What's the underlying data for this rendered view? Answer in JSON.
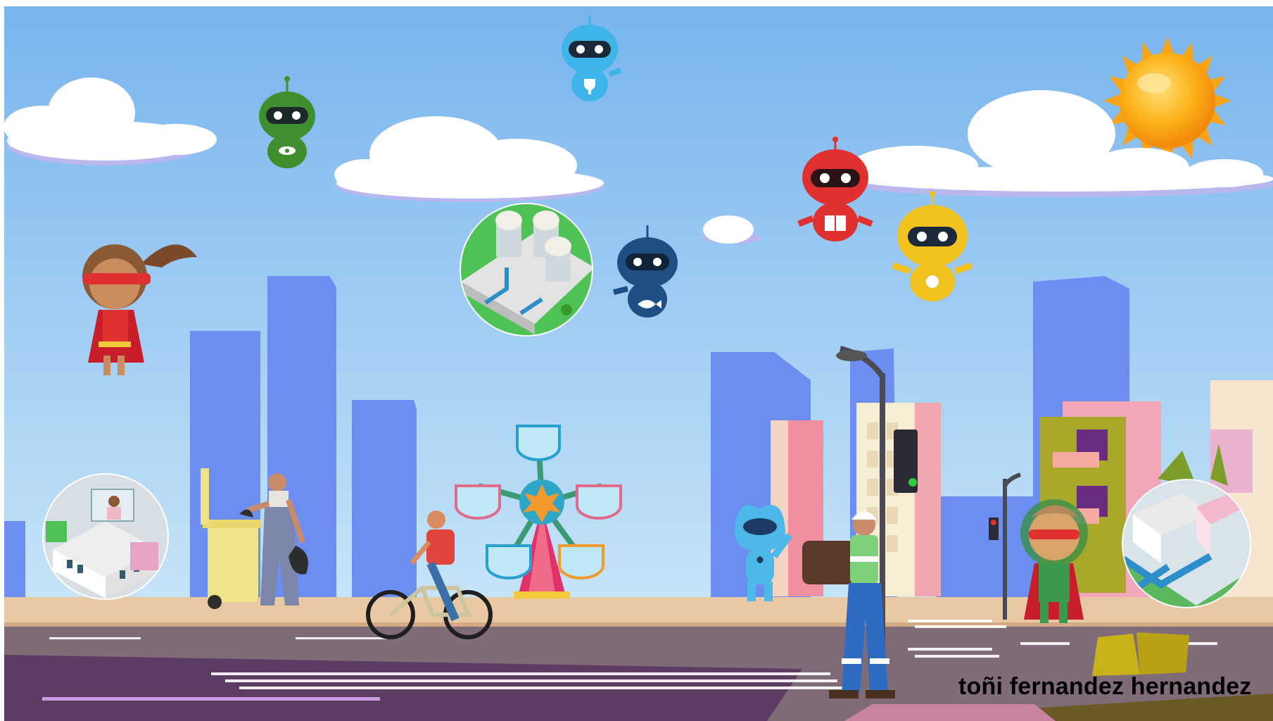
{
  "scene": {
    "credit_text": "toñi fernandez hernandez",
    "colors": {
      "sky_top": "#7ab6ef",
      "sky_bottom": "#cfe8f8",
      "buildings_far": "#6f8ff0",
      "sidewalk": "#e8c7a6",
      "road": "#7e6a78",
      "road_dark": "#5b3b62",
      "sun": "#fbb117"
    },
    "robots": [
      {
        "name": "robot-green",
        "color": "#3f8f2e",
        "badge": "eye-icon"
      },
      {
        "name": "robot-lightblue",
        "color": "#3fb4e8",
        "badge": "trophy-icon"
      },
      {
        "name": "robot-navy",
        "color": "#1f4e84",
        "badge": "fish-icon"
      },
      {
        "name": "robot-red",
        "color": "#e0302f",
        "badge": "book-icon"
      },
      {
        "name": "robot-yellow",
        "color": "#f1c21e",
        "badge": "sun-icon"
      }
    ],
    "medallions": [
      {
        "name": "water-tanks-medallion"
      },
      {
        "name": "teleworking-home-medallion"
      },
      {
        "name": "city-pipes-medallion"
      }
    ]
  }
}
